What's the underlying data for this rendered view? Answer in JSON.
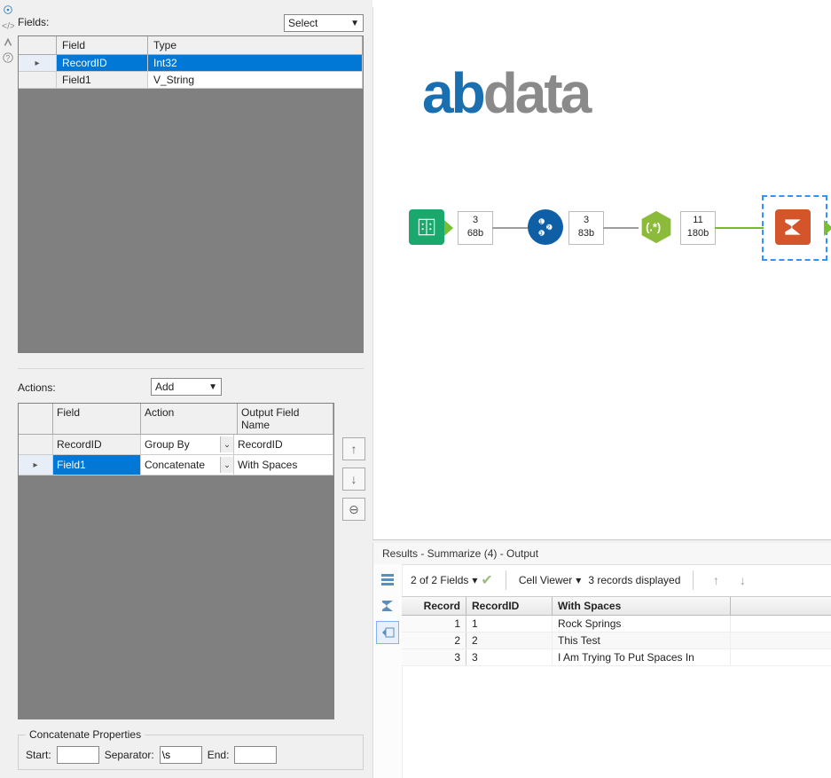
{
  "left": {
    "fields_label": "Fields:",
    "select_label": "Select",
    "fields_headers": {
      "field": "Field",
      "type": "Type"
    },
    "fields_rows": [
      {
        "field": "RecordID",
        "type": "Int32",
        "selected": true
      },
      {
        "field": "Field1",
        "type": "V_String",
        "selected": false
      }
    ],
    "actions_label": "Actions:",
    "add_label": "Add",
    "actions_headers": {
      "field": "Field",
      "action": "Action",
      "out": "Output Field Name"
    },
    "actions_rows": [
      {
        "field": "RecordID",
        "action": "Group By",
        "out": "RecordID",
        "selected": false
      },
      {
        "field": "Field1",
        "action": "Concatenate",
        "out": "With Spaces",
        "selected": true
      }
    ],
    "concat": {
      "legend": "Concatenate Properties",
      "start_label": "Start:",
      "start_val": "",
      "sep_label": "Separator:",
      "sep_val": "\\s",
      "end_label": "End:",
      "end_val": ""
    }
  },
  "canvas": {
    "logo_a": "ab",
    "logo_b": "data",
    "meta1": {
      "count": "3",
      "size": "68b"
    },
    "meta2": {
      "count": "3",
      "size": "83b"
    },
    "meta3": {
      "count": "11",
      "size": "180b"
    }
  },
  "results": {
    "title": "Results - Summarize (4) - Output",
    "fields_info": "2 of 2 Fields",
    "cell_viewer": "Cell Viewer",
    "records_info": "3 records displayed",
    "headers": {
      "rec": "Record",
      "id": "RecordID",
      "ws": "With Spaces"
    },
    "rows": [
      {
        "n": "1",
        "id": "1",
        "ws": "Rock Springs"
      },
      {
        "n": "2",
        "id": "2",
        "ws": "This Test"
      },
      {
        "n": "3",
        "id": "3",
        "ws": "I Am Trying To Put Spaces In"
      }
    ]
  }
}
